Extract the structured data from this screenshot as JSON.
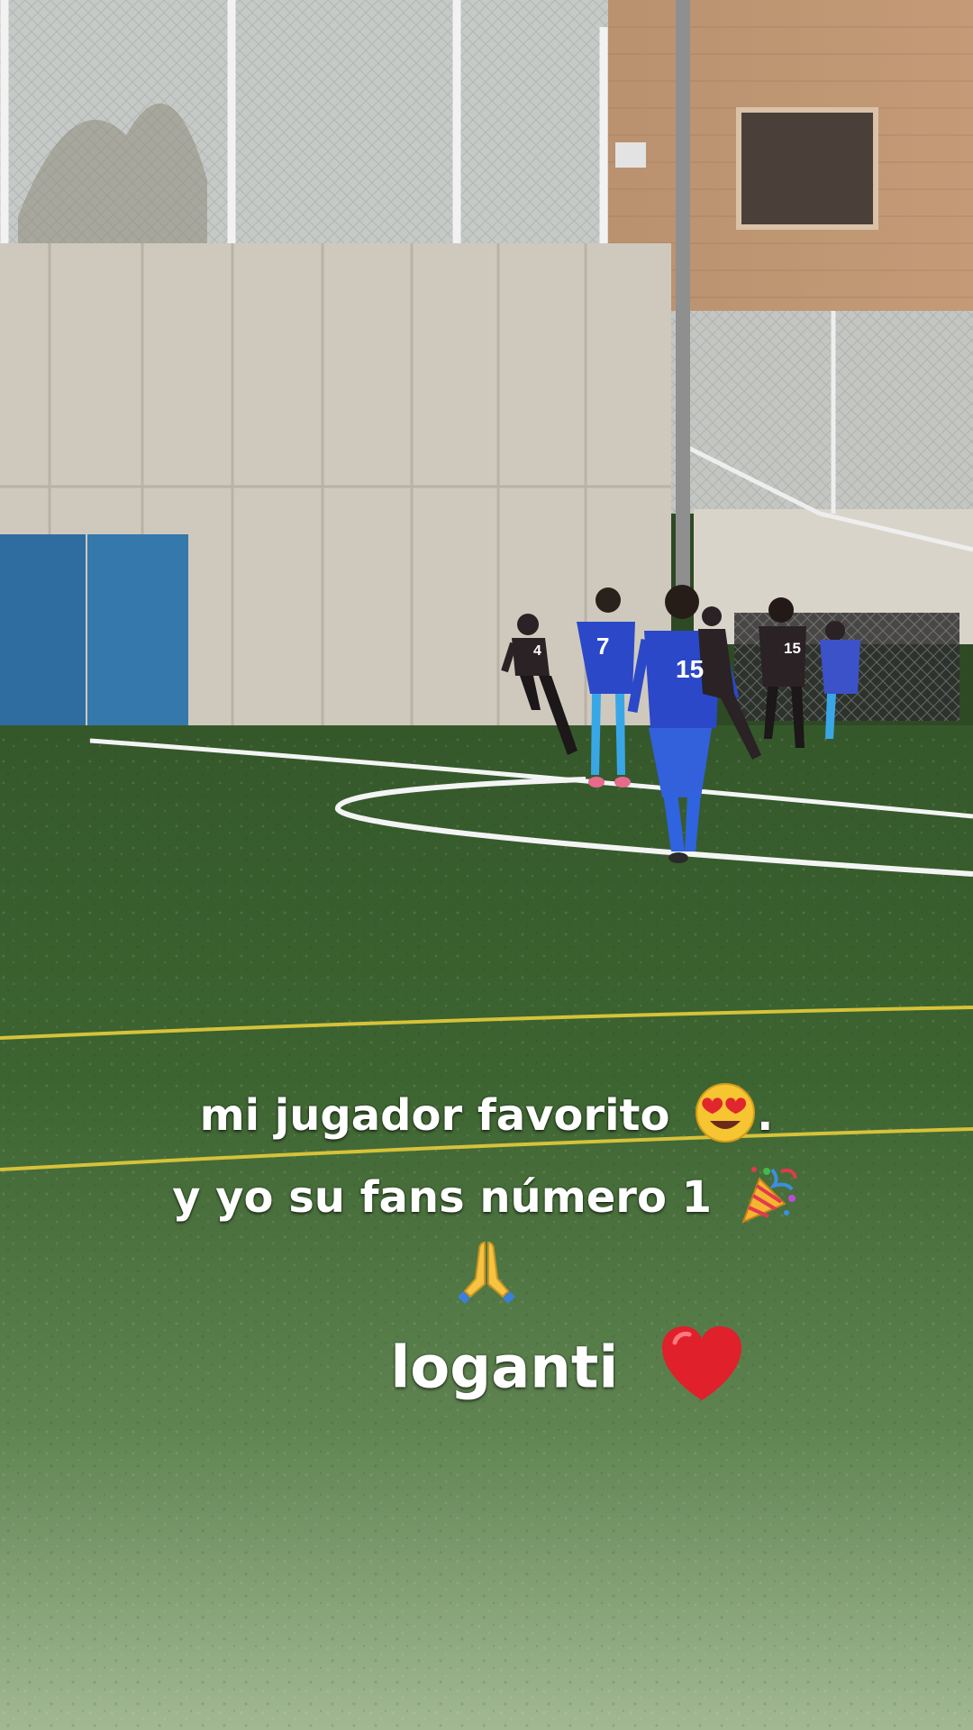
{
  "caption": {
    "line1_text": "mi jugador favorito",
    "line1_suffix": ".",
    "line2_text": "y yo su fans número 1",
    "line4_text": "loganti"
  },
  "players": {
    "blue_numbers": [
      "7",
      "15"
    ],
    "dark_numbers": [
      "4",
      "15"
    ]
  },
  "colors": {
    "turf": "#3f6a32",
    "turf_light": "#9fb48c",
    "wall": "#cfc9bd",
    "brick": "#b88f6c",
    "blue_kit": "#2b48c9",
    "dark_kit": "#2a2224",
    "pad": "#2f6da0",
    "heart": "#e0202a"
  },
  "icons": [
    "heart-eyes-emoji",
    "party-popper-emoji",
    "praying-hands-emoji",
    "red-heart-emoji"
  ]
}
